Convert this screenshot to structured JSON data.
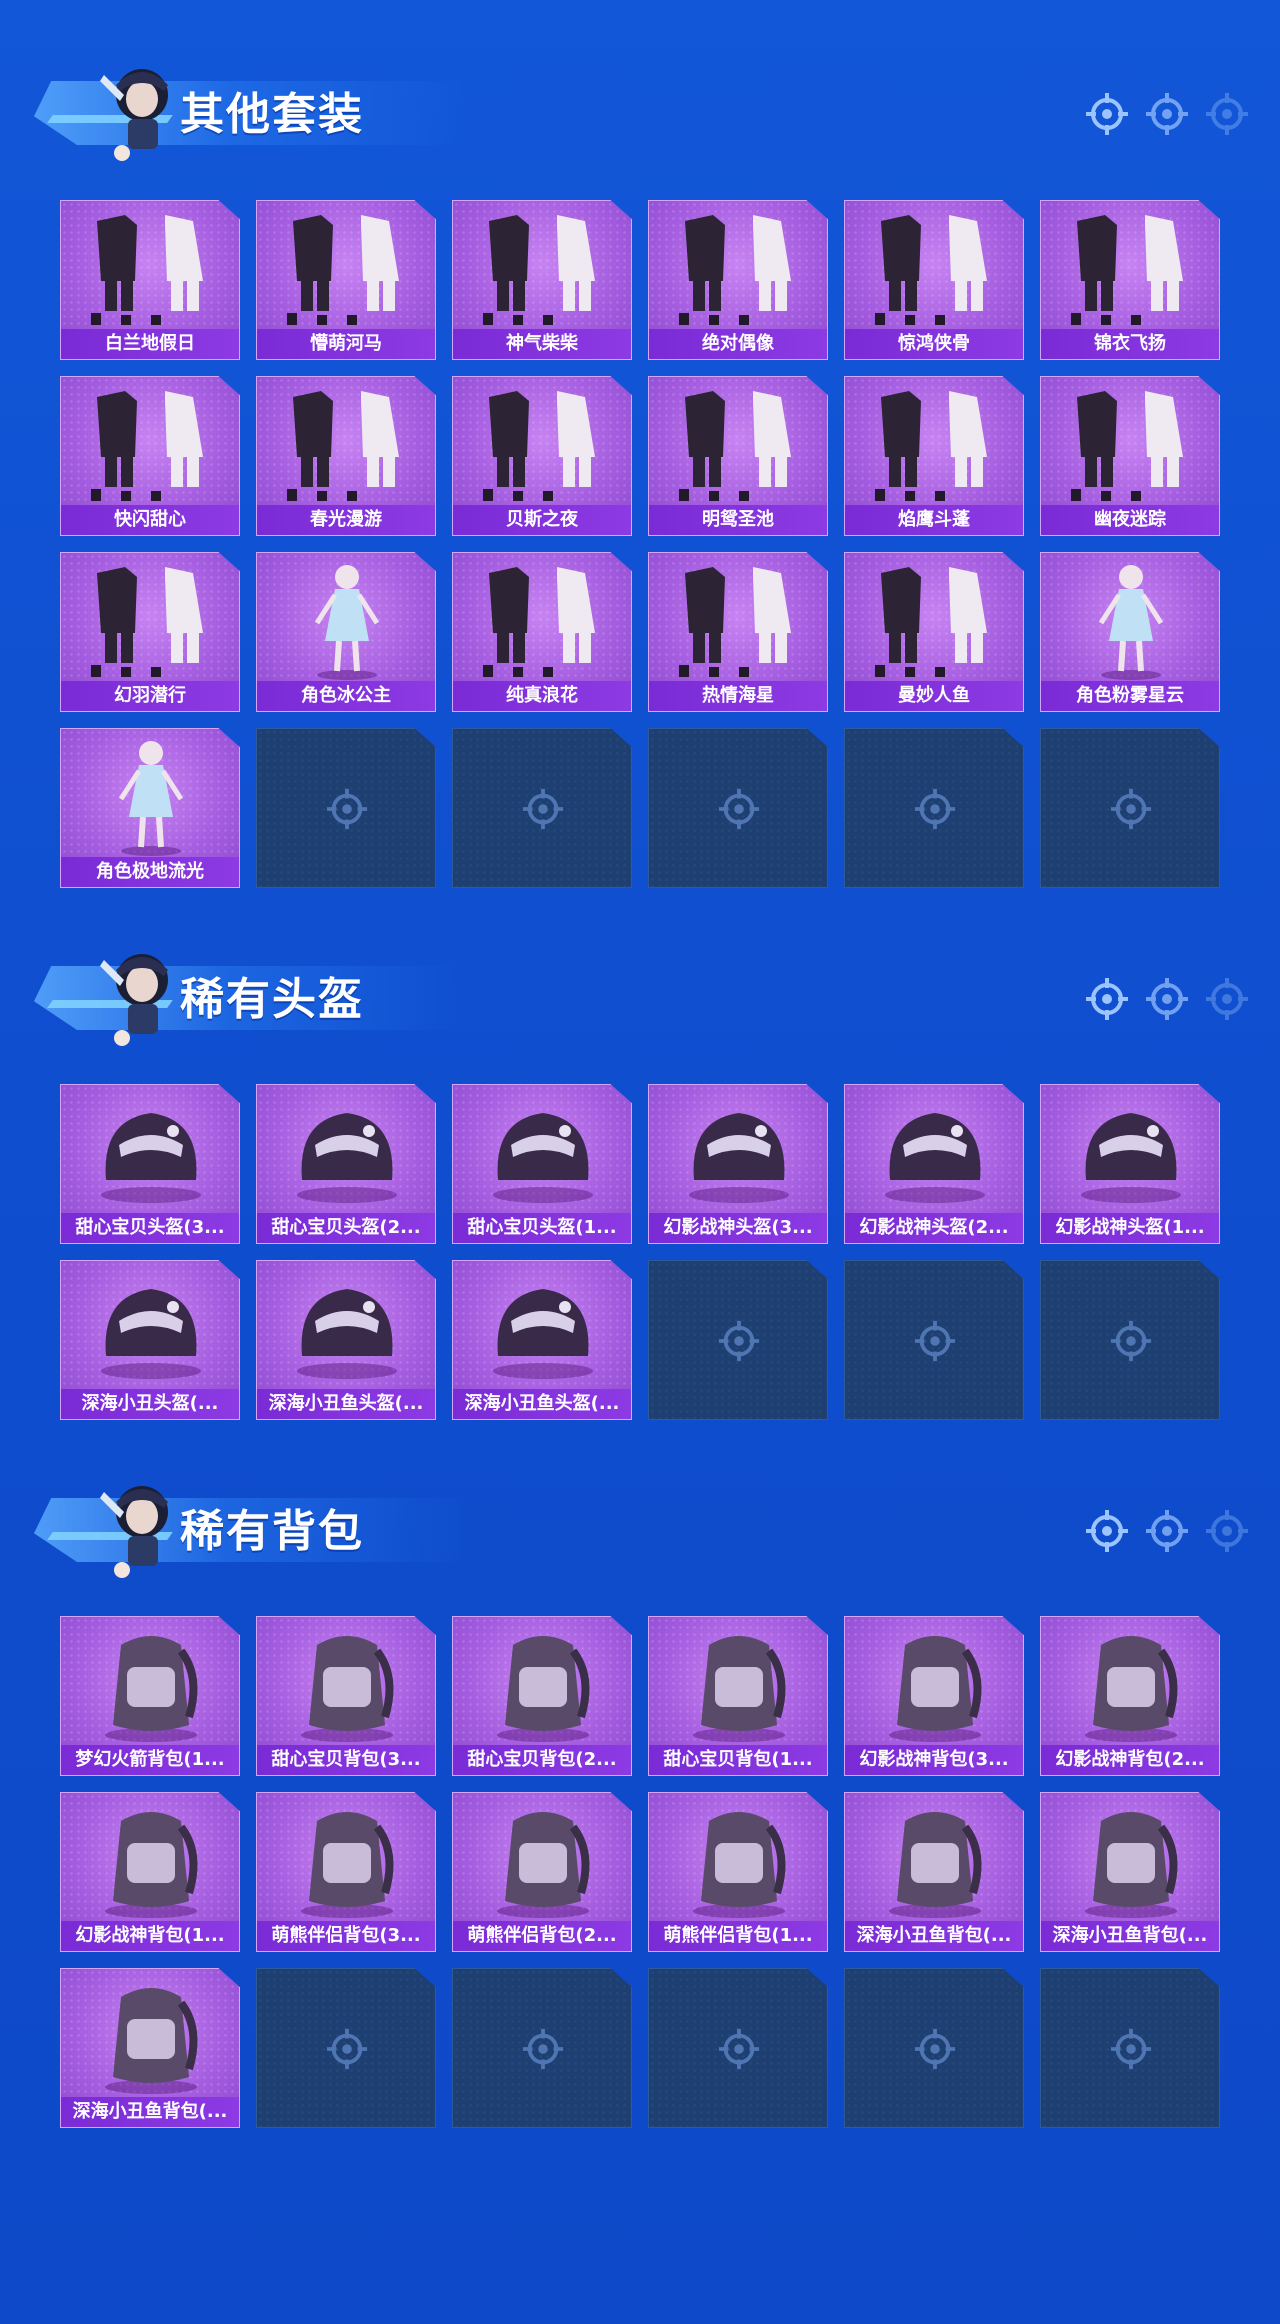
{
  "colors": {
    "background": "#1257d8",
    "card_purple": "#a55ee0",
    "caption_purple": "#7a2bd6",
    "empty_slot": "#1e3f72",
    "title_text": "#ffffff"
  },
  "sections": [
    {
      "title": "其他套装",
      "icon": "mascot-icon",
      "items": [
        {
          "label": "白兰地假日",
          "icon": "outfit-icon"
        },
        {
          "label": "懵萌河马",
          "icon": "outfit-icon"
        },
        {
          "label": "神气柴柴",
          "icon": "outfit-icon"
        },
        {
          "label": "绝对偶像",
          "icon": "outfit-icon"
        },
        {
          "label": "惊鸿侠骨",
          "icon": "outfit-icon"
        },
        {
          "label": "锦衣飞扬",
          "icon": "outfit-icon"
        },
        {
          "label": "快闪甜心",
          "icon": "outfit-icon"
        },
        {
          "label": "春光漫游",
          "icon": "outfit-icon"
        },
        {
          "label": "贝斯之夜",
          "icon": "outfit-icon"
        },
        {
          "label": "明鸳圣池",
          "icon": "outfit-icon"
        },
        {
          "label": "焰鹰斗蓬",
          "icon": "outfit-icon"
        },
        {
          "label": "幽夜迷踪",
          "icon": "outfit-icon"
        },
        {
          "label": "幻羽潜行",
          "icon": "outfit-icon"
        },
        {
          "label": "角色冰公主",
          "icon": "character-icon"
        },
        {
          "label": "纯真浪花",
          "icon": "outfit-icon"
        },
        {
          "label": "热情海星",
          "icon": "outfit-icon"
        },
        {
          "label": "曼妙人鱼",
          "icon": "outfit-icon"
        },
        {
          "label": "角色粉雾星云",
          "icon": "character-icon"
        },
        {
          "label": "角色极地流光",
          "icon": "character-icon"
        }
      ],
      "empty_slots": 5
    },
    {
      "title": "稀有头盔",
      "icon": "mascot-icon",
      "items": [
        {
          "label": "甜心宝贝头盔(3...",
          "icon": "helmet-icon"
        },
        {
          "label": "甜心宝贝头盔(2...",
          "icon": "helmet-icon"
        },
        {
          "label": "甜心宝贝头盔(1...",
          "icon": "helmet-icon"
        },
        {
          "label": "幻影战神头盔(3...",
          "icon": "helmet-icon"
        },
        {
          "label": "幻影战神头盔(2...",
          "icon": "helmet-icon"
        },
        {
          "label": "幻影战神头盔(1...",
          "icon": "helmet-icon"
        },
        {
          "label": "深海小丑头盔(...",
          "icon": "helmet-icon"
        },
        {
          "label": "深海小丑鱼头盔(...",
          "icon": "helmet-icon"
        },
        {
          "label": "深海小丑鱼头盔(...",
          "icon": "helmet-icon"
        }
      ],
      "empty_slots": 3
    },
    {
      "title": "稀有背包",
      "icon": "mascot-icon",
      "items": [
        {
          "label": "梦幻火箭背包(1...",
          "icon": "backpack-icon"
        },
        {
          "label": "甜心宝贝背包(3...",
          "icon": "backpack-icon"
        },
        {
          "label": "甜心宝贝背包(2...",
          "icon": "backpack-icon"
        },
        {
          "label": "甜心宝贝背包(1...",
          "icon": "backpack-icon"
        },
        {
          "label": "幻影战神背包(3...",
          "icon": "backpack-icon"
        },
        {
          "label": "幻影战神背包(2...",
          "icon": "backpack-icon"
        },
        {
          "label": "幻影战神背包(1...",
          "icon": "backpack-icon"
        },
        {
          "label": "萌熊伴侣背包(3...",
          "icon": "backpack-icon"
        },
        {
          "label": "萌熊伴侣背包(2...",
          "icon": "backpack-icon"
        },
        {
          "label": "萌熊伴侣背包(1...",
          "icon": "backpack-icon"
        },
        {
          "label": "深海小丑鱼背包(...",
          "icon": "backpack-icon"
        },
        {
          "label": "深海小丑鱼背包(...",
          "icon": "backpack-icon"
        },
        {
          "label": "深海小丑鱼背包(...",
          "icon": "backpack-icon"
        }
      ],
      "empty_slots": 5
    }
  ]
}
